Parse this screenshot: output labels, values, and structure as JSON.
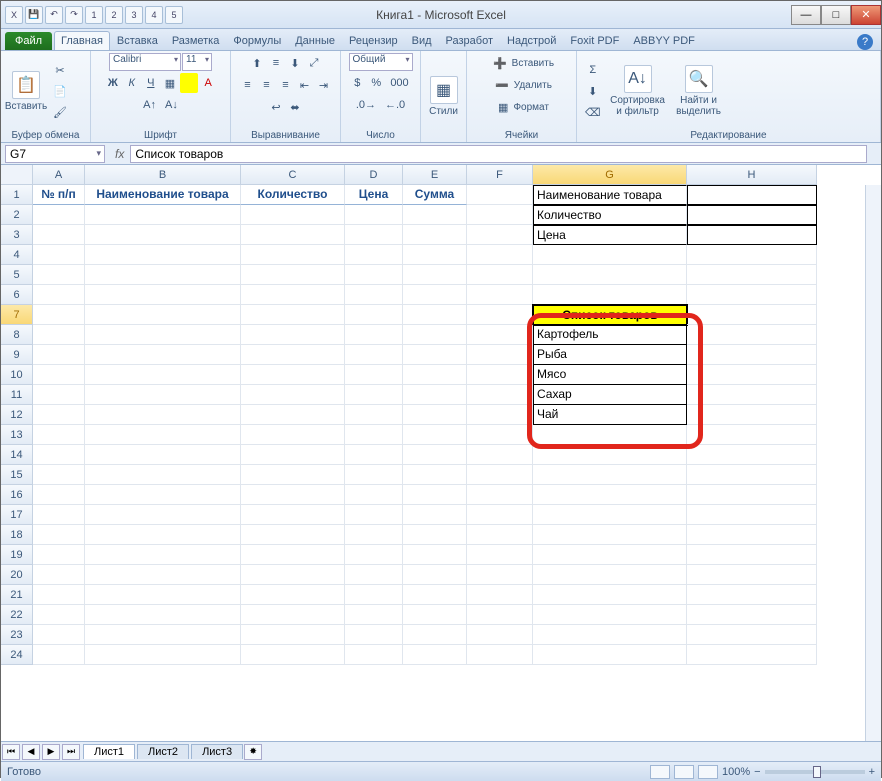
{
  "title": "Книга1  -  Microsoft Excel",
  "qa": [
    "X",
    "💾",
    "↶",
    "↷",
    "1",
    "2",
    "3",
    "4",
    "5"
  ],
  "winbtns": {
    "min": "—",
    "max": "□",
    "close": "✕"
  },
  "tabs": {
    "file": "Файл",
    "items": [
      "Главная",
      "Вставка",
      "Разметка",
      "Формулы",
      "Данные",
      "Рецензир",
      "Вид",
      "Разработ",
      "Надстрой",
      "Foxit PDF",
      "ABBYY PDF"
    ],
    "active": 0
  },
  "ribbon": {
    "clipboard": {
      "label": "Буфер обмена",
      "paste": "Вставить"
    },
    "font": {
      "label": "Шрифт",
      "name": "Calibri",
      "size": "11",
      "btns": [
        "Ж",
        "К",
        "Ч"
      ]
    },
    "align": {
      "label": "Выравнивание"
    },
    "number": {
      "label": "Число",
      "fmt": "Общий"
    },
    "styles": {
      "label": "",
      "btn": "Стили"
    },
    "cells": {
      "label": "Ячейки",
      "insert": "Вставить",
      "delete": "Удалить",
      "format": "Формат"
    },
    "editing": {
      "label": "Редактирование",
      "sort": "Сортировка и фильтр",
      "find": "Найти и выделить"
    }
  },
  "formulabar": {
    "cell": "G7",
    "value": "Список товаров",
    "fx": "fx"
  },
  "columns": [
    "A",
    "B",
    "C",
    "D",
    "E",
    "F",
    "G",
    "H"
  ],
  "rows_count": 24,
  "headers_row1": {
    "A": "№ п/п",
    "B": "Наименование товара",
    "C": "Количество",
    "D": "Цена",
    "E": "Сумма"
  },
  "side_table": {
    "G1": "Наименование товара",
    "G2": "Количество",
    "G3": "Цена"
  },
  "list": {
    "title": "Список товаров",
    "items": [
      "Картофель",
      "Рыба",
      "Мясо",
      "Сахар",
      "Чай"
    ]
  },
  "sheets": [
    "Лист1",
    "Лист2",
    "Лист3"
  ],
  "status": {
    "ready": "Готово",
    "zoom": "100%",
    "minus": "−",
    "plus": "+"
  }
}
